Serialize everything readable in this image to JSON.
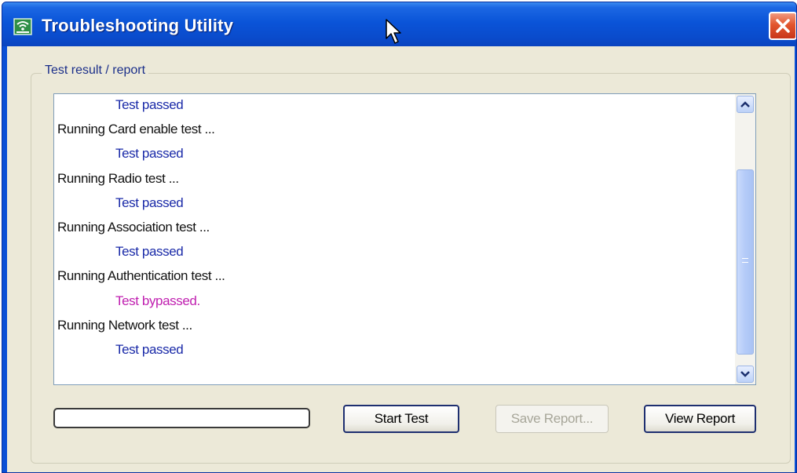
{
  "window": {
    "title": "Troubleshooting Utility"
  },
  "group": {
    "label": "Test result / report"
  },
  "log": {
    "lines": [
      {
        "type": "passed",
        "text": "Test passed"
      },
      {
        "type": "running",
        "text": "Running Card enable test ..."
      },
      {
        "type": "passed",
        "text": "Test passed"
      },
      {
        "type": "running",
        "text": "Running Radio test ..."
      },
      {
        "type": "passed",
        "text": "Test passed"
      },
      {
        "type": "running",
        "text": "Running Association test ..."
      },
      {
        "type": "passed",
        "text": "Test passed"
      },
      {
        "type": "running",
        "text": "Running Authentication test ..."
      },
      {
        "type": "bypassed",
        "text": "Test bypassed."
      },
      {
        "type": "running",
        "text": "Running Network test ..."
      },
      {
        "type": "passed",
        "text": "Test passed"
      }
    ]
  },
  "progress": {
    "value": 0
  },
  "buttons": {
    "start_test": "Start Test",
    "save_report": "Save Report...",
    "view_report": "View Report"
  },
  "colors": {
    "titlebar": "#0a54d8",
    "passed_text": "#1a2aa8",
    "bypassed_text": "#c020b0",
    "close_button": "#e2552d",
    "client_bg": "#ece9d8"
  },
  "icons": {
    "app": "wifi-network-icon",
    "close": "close-icon",
    "scroll_up": "chevron-up-icon",
    "scroll_down": "chevron-down-icon",
    "pointer": "mouse-pointer-icon"
  }
}
